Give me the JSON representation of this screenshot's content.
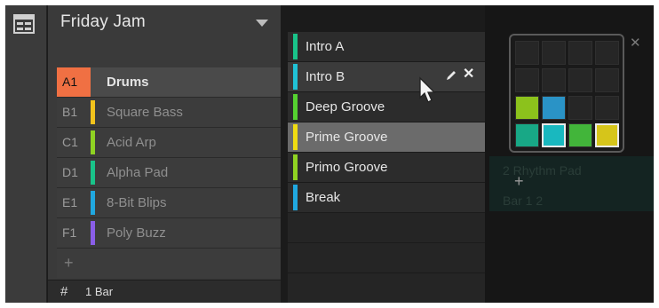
{
  "group": {
    "title": "Friday Jam",
    "items": [
      {
        "slot": "A1",
        "name": "Drums",
        "color": "#f07043",
        "selected": true
      },
      {
        "slot": "B1",
        "name": "Square Bass",
        "color": "#f2c31c",
        "selected": false
      },
      {
        "slot": "C1",
        "name": "Acid Arp",
        "color": "#8fd222",
        "selected": false
      },
      {
        "slot": "D1",
        "name": "Alpha Pad",
        "color": "#19c389",
        "selected": false
      },
      {
        "slot": "E1",
        "name": "8-Bit Blips",
        "color": "#20a8e0",
        "selected": false
      },
      {
        "slot": "F1",
        "name": "Poly Buzz",
        "color": "#8a5ee8",
        "selected": false
      }
    ],
    "add_label": "+",
    "footer_icon": "#",
    "footer_length": "1 Bar"
  },
  "scenes": {
    "items": [
      {
        "name": "Intro A",
        "color": "#19c389"
      },
      {
        "name": "Intro B",
        "color": "#20c2d6"
      },
      {
        "name": "Deep Groove",
        "color": "#55d130"
      },
      {
        "name": "Prime Groove",
        "color": "#f0dc12"
      },
      {
        "name": "Primo Groove",
        "color": "#8fd222"
      },
      {
        "name": "Break",
        "color": "#20a8e0"
      }
    ],
    "hovered_index": 1,
    "selected_index": 3,
    "close_glyph": "✕"
  },
  "grid_popup": {
    "close_glyph": "✕",
    "rows": [
      [
        "#262626",
        "#262626",
        "#262626",
        "#262626"
      ],
      [
        "#262626",
        "#262626",
        "#262626",
        "#262626"
      ],
      [
        "#8cc21c",
        "#2a93c6",
        "#262626",
        "#262626"
      ],
      [
        "#18a886",
        "#19b8bf",
        "#42b53a",
        "#d6c51a"
      ]
    ],
    "highlighted": [
      [
        3,
        1
      ],
      [
        3,
        3
      ]
    ]
  },
  "background": {
    "plus_label": "+",
    "ghost_text_1": "2 Rhythm Pad",
    "ghost_text_2": "Bar 1 2"
  },
  "icons": {
    "strip": "layout-icon",
    "dropdown": "triangle-down-icon",
    "edit": "pencil-icon",
    "close": "close-icon",
    "cursor": "mouse-pointer-icon"
  }
}
